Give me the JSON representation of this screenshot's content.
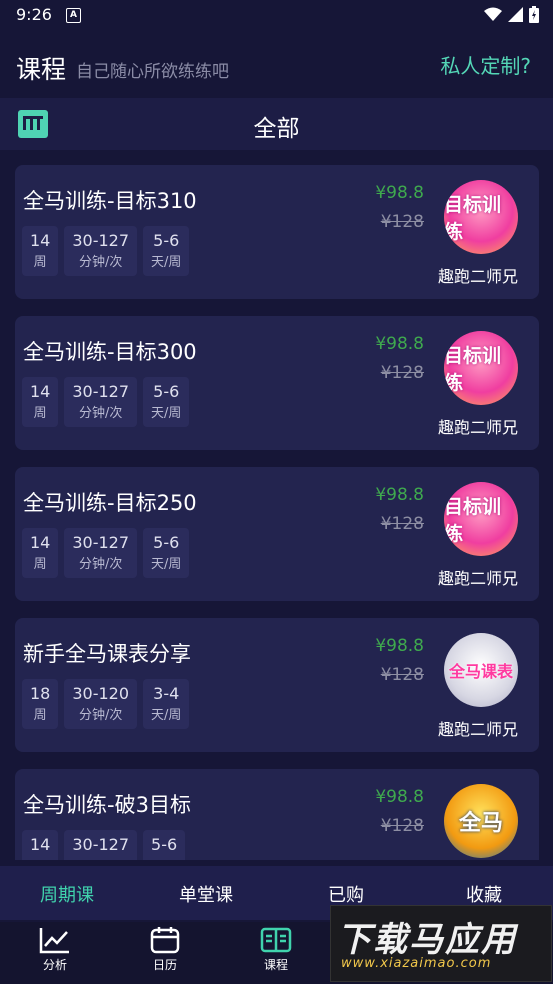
{
  "status": {
    "time": "9:26",
    "a_badge": "A"
  },
  "header": {
    "title": "课程",
    "subtitle": "自己随心所欲练练吧",
    "custom_link": "私人定制?"
  },
  "filter": {
    "label": "全部"
  },
  "cards": [
    {
      "title": "全马训练-目标310",
      "price": "¥98.8",
      "orig_price": "¥128",
      "thumb_text": "目标训练",
      "author": "趣跑二师兄",
      "tags": [
        {
          "v": "14",
          "u": "周"
        },
        {
          "v": "30-127",
          "u": "分钟/次"
        },
        {
          "v": "5-6",
          "u": "天/周"
        }
      ]
    },
    {
      "title": "全马训练-目标300",
      "price": "¥98.8",
      "orig_price": "¥128",
      "thumb_text": "目标训练",
      "author": "趣跑二师兄",
      "tags": [
        {
          "v": "14",
          "u": "周"
        },
        {
          "v": "30-127",
          "u": "分钟/次"
        },
        {
          "v": "5-6",
          "u": "天/周"
        }
      ]
    },
    {
      "title": "全马训练-目标250",
      "price": "¥98.8",
      "orig_price": "¥128",
      "thumb_text": "目标训练",
      "author": "趣跑二师兄",
      "tags": [
        {
          "v": "14",
          "u": "周"
        },
        {
          "v": "30-127",
          "u": "分钟/次"
        },
        {
          "v": "5-6",
          "u": "天/周"
        }
      ]
    },
    {
      "title": "新手全马课表分享",
      "price": "¥98.8",
      "orig_price": "¥128",
      "thumb_text": "全马课表",
      "author": "趣跑二师兄",
      "tags": [
        {
          "v": "18",
          "u": "周"
        },
        {
          "v": "30-120",
          "u": "分钟/次"
        },
        {
          "v": "3-4",
          "u": "天/周"
        }
      ]
    },
    {
      "title": "全马训练-破3目标",
      "price": "¥98.8",
      "orig_price": "¥128",
      "thumb_text": "全马",
      "author": "",
      "tags": [
        {
          "v": "14",
          "u": ""
        },
        {
          "v": "30-127",
          "u": ""
        },
        {
          "v": "5-6",
          "u": ""
        }
      ]
    }
  ],
  "tabs": [
    "周期课",
    "单堂课",
    "已购",
    "收藏"
  ],
  "nav": [
    {
      "label": "分析"
    },
    {
      "label": "日历"
    },
    {
      "label": "课程"
    }
  ],
  "watermark": {
    "big": "下载马应用",
    "small": "www.xiazaimao.com"
  },
  "colors": {
    "accent": "#40d3ad",
    "price": "#3fa94e",
    "background": "#161637",
    "card": "#23244f"
  }
}
